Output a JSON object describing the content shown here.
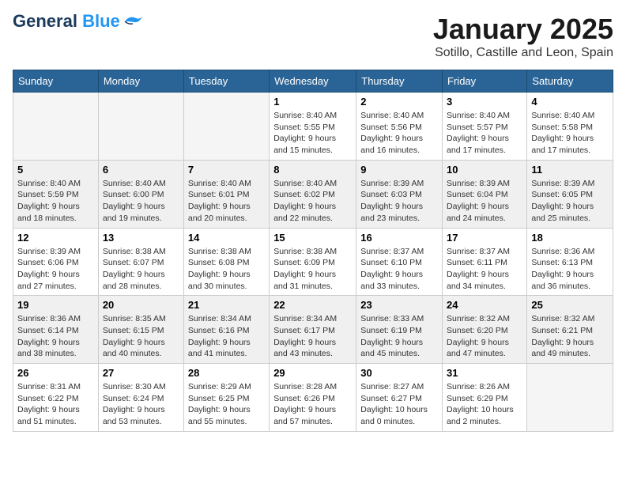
{
  "logo": {
    "general": "General",
    "blue": "Blue"
  },
  "header": {
    "month": "January 2025",
    "location": "Sotillo, Castille and Leon, Spain"
  },
  "weekdays": [
    "Sunday",
    "Monday",
    "Tuesday",
    "Wednesday",
    "Thursday",
    "Friday",
    "Saturday"
  ],
  "weeks": [
    {
      "shaded": false,
      "days": [
        {
          "num": "",
          "info": ""
        },
        {
          "num": "",
          "info": ""
        },
        {
          "num": "",
          "info": ""
        },
        {
          "num": "1",
          "info": "Sunrise: 8:40 AM\nSunset: 5:55 PM\nDaylight: 9 hours\nand 15 minutes."
        },
        {
          "num": "2",
          "info": "Sunrise: 8:40 AM\nSunset: 5:56 PM\nDaylight: 9 hours\nand 16 minutes."
        },
        {
          "num": "3",
          "info": "Sunrise: 8:40 AM\nSunset: 5:57 PM\nDaylight: 9 hours\nand 17 minutes."
        },
        {
          "num": "4",
          "info": "Sunrise: 8:40 AM\nSunset: 5:58 PM\nDaylight: 9 hours\nand 17 minutes."
        }
      ]
    },
    {
      "shaded": true,
      "days": [
        {
          "num": "5",
          "info": "Sunrise: 8:40 AM\nSunset: 5:59 PM\nDaylight: 9 hours\nand 18 minutes."
        },
        {
          "num": "6",
          "info": "Sunrise: 8:40 AM\nSunset: 6:00 PM\nDaylight: 9 hours\nand 19 minutes."
        },
        {
          "num": "7",
          "info": "Sunrise: 8:40 AM\nSunset: 6:01 PM\nDaylight: 9 hours\nand 20 minutes."
        },
        {
          "num": "8",
          "info": "Sunrise: 8:40 AM\nSunset: 6:02 PM\nDaylight: 9 hours\nand 22 minutes."
        },
        {
          "num": "9",
          "info": "Sunrise: 8:39 AM\nSunset: 6:03 PM\nDaylight: 9 hours\nand 23 minutes."
        },
        {
          "num": "10",
          "info": "Sunrise: 8:39 AM\nSunset: 6:04 PM\nDaylight: 9 hours\nand 24 minutes."
        },
        {
          "num": "11",
          "info": "Sunrise: 8:39 AM\nSunset: 6:05 PM\nDaylight: 9 hours\nand 25 minutes."
        }
      ]
    },
    {
      "shaded": false,
      "days": [
        {
          "num": "12",
          "info": "Sunrise: 8:39 AM\nSunset: 6:06 PM\nDaylight: 9 hours\nand 27 minutes."
        },
        {
          "num": "13",
          "info": "Sunrise: 8:38 AM\nSunset: 6:07 PM\nDaylight: 9 hours\nand 28 minutes."
        },
        {
          "num": "14",
          "info": "Sunrise: 8:38 AM\nSunset: 6:08 PM\nDaylight: 9 hours\nand 30 minutes."
        },
        {
          "num": "15",
          "info": "Sunrise: 8:38 AM\nSunset: 6:09 PM\nDaylight: 9 hours\nand 31 minutes."
        },
        {
          "num": "16",
          "info": "Sunrise: 8:37 AM\nSunset: 6:10 PM\nDaylight: 9 hours\nand 33 minutes."
        },
        {
          "num": "17",
          "info": "Sunrise: 8:37 AM\nSunset: 6:11 PM\nDaylight: 9 hours\nand 34 minutes."
        },
        {
          "num": "18",
          "info": "Sunrise: 8:36 AM\nSunset: 6:13 PM\nDaylight: 9 hours\nand 36 minutes."
        }
      ]
    },
    {
      "shaded": true,
      "days": [
        {
          "num": "19",
          "info": "Sunrise: 8:36 AM\nSunset: 6:14 PM\nDaylight: 9 hours\nand 38 minutes."
        },
        {
          "num": "20",
          "info": "Sunrise: 8:35 AM\nSunset: 6:15 PM\nDaylight: 9 hours\nand 40 minutes."
        },
        {
          "num": "21",
          "info": "Sunrise: 8:34 AM\nSunset: 6:16 PM\nDaylight: 9 hours\nand 41 minutes."
        },
        {
          "num": "22",
          "info": "Sunrise: 8:34 AM\nSunset: 6:17 PM\nDaylight: 9 hours\nand 43 minutes."
        },
        {
          "num": "23",
          "info": "Sunrise: 8:33 AM\nSunset: 6:19 PM\nDaylight: 9 hours\nand 45 minutes."
        },
        {
          "num": "24",
          "info": "Sunrise: 8:32 AM\nSunset: 6:20 PM\nDaylight: 9 hours\nand 47 minutes."
        },
        {
          "num": "25",
          "info": "Sunrise: 8:32 AM\nSunset: 6:21 PM\nDaylight: 9 hours\nand 49 minutes."
        }
      ]
    },
    {
      "shaded": false,
      "days": [
        {
          "num": "26",
          "info": "Sunrise: 8:31 AM\nSunset: 6:22 PM\nDaylight: 9 hours\nand 51 minutes."
        },
        {
          "num": "27",
          "info": "Sunrise: 8:30 AM\nSunset: 6:24 PM\nDaylight: 9 hours\nand 53 minutes."
        },
        {
          "num": "28",
          "info": "Sunrise: 8:29 AM\nSunset: 6:25 PM\nDaylight: 9 hours\nand 55 minutes."
        },
        {
          "num": "29",
          "info": "Sunrise: 8:28 AM\nSunset: 6:26 PM\nDaylight: 9 hours\nand 57 minutes."
        },
        {
          "num": "30",
          "info": "Sunrise: 8:27 AM\nSunset: 6:27 PM\nDaylight: 10 hours\nand 0 minutes."
        },
        {
          "num": "31",
          "info": "Sunrise: 8:26 AM\nSunset: 6:29 PM\nDaylight: 10 hours\nand 2 minutes."
        },
        {
          "num": "",
          "info": ""
        }
      ]
    }
  ]
}
